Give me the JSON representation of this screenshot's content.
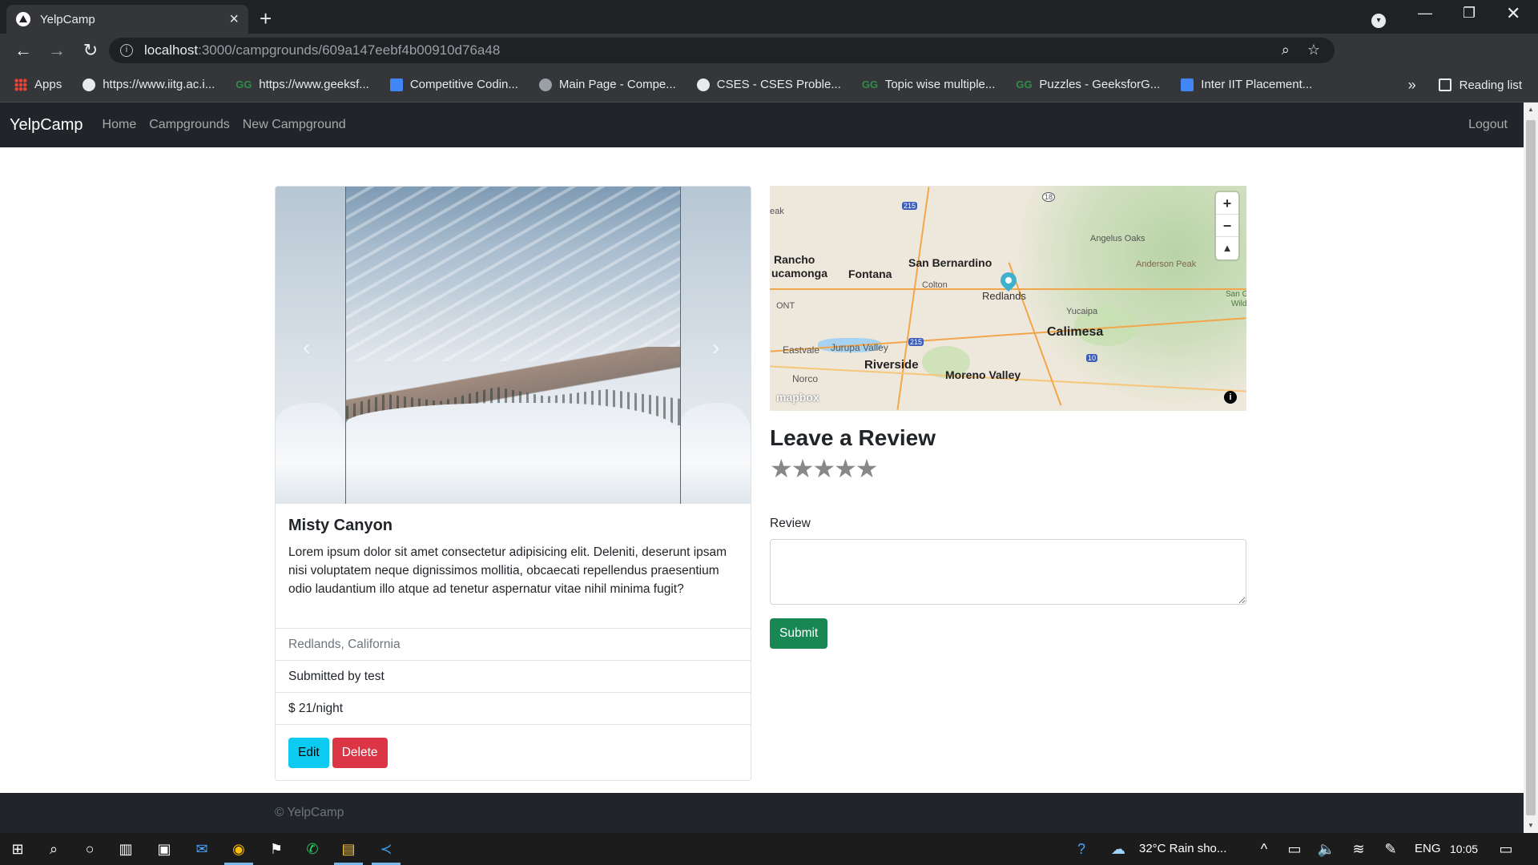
{
  "browser": {
    "tab_title": "YelpCamp",
    "url_host": "localhost",
    "url_path": ":3000/campgrounds/609a147eebf4b00910d76a48",
    "bookmarks": [
      {
        "label": "Apps",
        "icon": "apps-grid-icon"
      },
      {
        "label": "https://www.iitg.ac.i...",
        "icon": "globe-icon"
      },
      {
        "label": "https://www.geeksf...",
        "icon": "geeksforgeeks-icon"
      },
      {
        "label": "Competitive Codin...",
        "icon": "google-doc-icon"
      },
      {
        "label": "Main Page - Compe...",
        "icon": "site-face-icon"
      },
      {
        "label": "CSES - CSES Proble...",
        "icon": "globe-icon"
      },
      {
        "label": "Topic wise multiple...",
        "icon": "geeksforgeeks-icon"
      },
      {
        "label": "Puzzles - GeeksforG...",
        "icon": "geeksforgeeks-icon"
      },
      {
        "label": "Inter IIT Placement...",
        "icon": "google-doc-icon"
      }
    ],
    "reading_list": "Reading list"
  },
  "navbar": {
    "brand": "YelpCamp",
    "links": [
      "Home",
      "Campgrounds",
      "New Campground"
    ],
    "logout": "Logout"
  },
  "campground": {
    "title": "Misty Canyon",
    "description": "Lorem ipsum dolor sit amet consectetur adipisicing elit. Deleniti, deserunt ipsam nisi voluptatem neque dignissimos mollitia, obcaecati repellendus praesentium odio laudantium illo atque ad tenetur aspernatur vitae nihil minima fugit?",
    "location": "Redlands, California",
    "submitted_by": "Submitted by test",
    "price": "$ 21/night",
    "edit_label": "Edit",
    "delete_label": "Delete"
  },
  "map": {
    "labels": {
      "rancho": "Rancho",
      "cucamonga": "ucamonga",
      "fontana": "Fontana",
      "san_bernardino": "San Bernardino",
      "colton": "Colton",
      "redlands": "Redlands",
      "yucaipa": "Yucaipa",
      "calimesa": "Calimesa",
      "eastvale": "Eastvale",
      "jurupa_valley": "Jurupa Valley",
      "riverside": "Riverside",
      "moreno_valley": "Moreno Valley",
      "norco": "Norco",
      "angelus_oaks": "Angelus Oaks",
      "anderson_peak": "Anderson Peak",
      "ont": "ONT",
      "san_g": "San G",
      "wild": "Wild",
      "oak": "eak"
    },
    "shields": {
      "i215_north": "215",
      "i215_south": "215",
      "i10": "10",
      "r18": "18"
    },
    "zoom_in": "+",
    "zoom_out": "−",
    "compass": "▲",
    "attribution_logo": "mapbox",
    "info": "i"
  },
  "review": {
    "title": "Leave a Review",
    "stars": 5,
    "label": "Review",
    "textarea_value": "",
    "submit_label": "Submit"
  },
  "footer": {
    "text": "© YelpCamp"
  },
  "taskbar": {
    "weather": "32°C  Rain sho...",
    "language": "ENG",
    "time": "10:05"
  },
  "colors": {
    "navbar_bg": "#212529",
    "info_button": "#0dcaf0",
    "danger_button": "#dc3545",
    "success_button": "#198754",
    "map_pin": "#3fb1ce"
  }
}
